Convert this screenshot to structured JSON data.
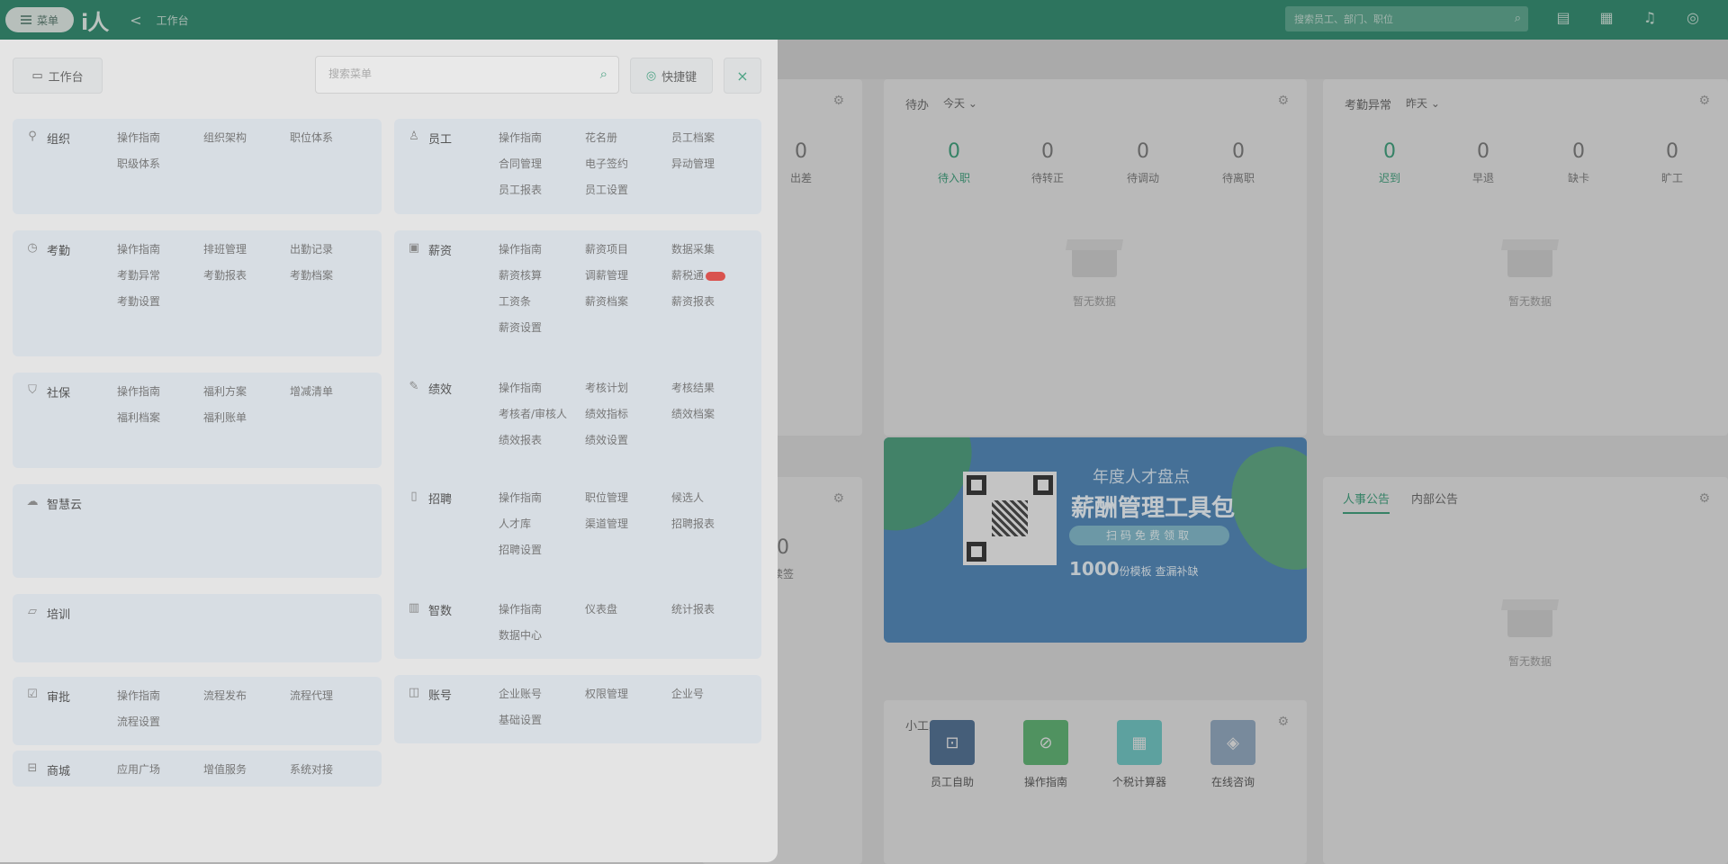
{
  "topbar": {
    "menu_label": "菜单",
    "logo": "i人",
    "back": "<",
    "crumb": "工作台",
    "search_placeholder": "搜索员工、部门、职位",
    "icons": [
      "doc-icon",
      "grid-icon",
      "bell-icon",
      "help-icon"
    ]
  },
  "panel": {
    "workbench_label": "工作台",
    "search_placeholder": "搜索菜单",
    "shortcut_label": "快捷键",
    "close_label": "×",
    "modules": [
      {
        "name": "组织",
        "icon": "org-icon",
        "items": [
          "操作指南",
          "组织架构",
          "职位体系",
          "职级体系"
        ]
      },
      {
        "name": "员工",
        "icon": "person-icon",
        "items": [
          "操作指南",
          "花名册",
          "员工档案",
          "合同管理",
          "电子签约",
          "异动管理",
          "员工报表",
          "员工设置"
        ]
      },
      {
        "name": "考勤",
        "icon": "clock-icon",
        "items": [
          "操作指南",
          "排班管理",
          "出勤记录",
          "考勤异常",
          "考勤报表",
          "考勤档案",
          "考勤设置"
        ]
      },
      {
        "name": "薪资",
        "icon": "salary-icon",
        "items": [
          "操作指南",
          "薪资项目",
          "数据采集",
          "薪资核算",
          "调薪管理",
          "薪税通",
          "工资条",
          "薪资档案",
          "薪资报表",
          "薪资设置"
        ],
        "badge_item": 5
      },
      {
        "name": "社保",
        "icon": "shield-icon",
        "items": [
          "操作指南",
          "福利方案",
          "增减清单",
          "福利档案",
          "福利账单"
        ]
      },
      {
        "name": "绩效",
        "icon": "edit-icon",
        "items": [
          "操作指南",
          "考核计划",
          "考核结果",
          "考核者/审核人",
          "绩效指标",
          "绩效档案",
          "绩效报表",
          "绩效设置"
        ]
      },
      {
        "name": "智慧云",
        "icon": "cloud-icon",
        "items": []
      },
      {
        "name": "招聘",
        "icon": "doc-icon",
        "items": [
          "操作指南",
          "职位管理",
          "候选人",
          "人才库",
          "渠道管理",
          "招聘报表",
          "招聘设置"
        ]
      },
      {
        "name": "培训",
        "icon": "book-icon",
        "items": []
      },
      {
        "name": "智数",
        "icon": "chart-icon",
        "items": [
          "操作指南",
          "仪表盘",
          "统计报表",
          "数据中心"
        ]
      },
      {
        "name": "审批",
        "icon": "approve-icon",
        "items": [
          "操作指南",
          "流程发布",
          "流程代理",
          "流程设置"
        ]
      },
      {
        "name": "账号",
        "icon": "account-icon",
        "items": [
          "企业账号",
          "权限管理",
          "企业号",
          "基础设置"
        ]
      },
      {
        "name": "商城",
        "icon": "shop-icon",
        "items": [
          "应用广场",
          "增值服务",
          "系统对接"
        ]
      }
    ]
  },
  "dashboard": {
    "card1": {
      "value": "0",
      "label": "出差"
    },
    "todo": {
      "title": "待办",
      "dropdown": "今天",
      "stats": [
        {
          "value": "0",
          "label": "待入职"
        },
        {
          "value": "0",
          "label": "待转正"
        },
        {
          "value": "0",
          "label": "待调动"
        },
        {
          "value": "0",
          "label": "待离职"
        }
      ],
      "empty": "暂无数据"
    },
    "attendance": {
      "title": "考勤异常",
      "dropdown": "昨天",
      "stats": [
        {
          "value": "0",
          "label": "迟到"
        },
        {
          "value": "0",
          "label": "早退"
        },
        {
          "value": "0",
          "label": "缺卡"
        },
        {
          "value": "0",
          "label": "旷工"
        }
      ],
      "empty": "暂无数据"
    },
    "card4": {
      "value": "0",
      "label": "续签"
    },
    "banner": {
      "line1": "年度人才盘点",
      "line2": "薪酬管理工具包",
      "line3": "扫码免费领取",
      "line4": "1000",
      "line4_small": "份模板 查漏补缺"
    },
    "tools": {
      "title": "小工具",
      "items": [
        {
          "label": "员工自助",
          "icon": "self-service-icon",
          "color": "#4d6d90"
        },
        {
          "label": "操作指南",
          "icon": "compass-icon",
          "color": "#5bb070"
        },
        {
          "label": "个税计算器",
          "icon": "calculator-icon",
          "color": "#6cc3c0"
        },
        {
          "label": "在线咨询",
          "icon": "chat-icon",
          "color": "#8fa6bd"
        }
      ]
    },
    "notices": {
      "tabs": [
        "人事公告",
        "内部公告"
      ],
      "empty": "暂无数据"
    }
  }
}
